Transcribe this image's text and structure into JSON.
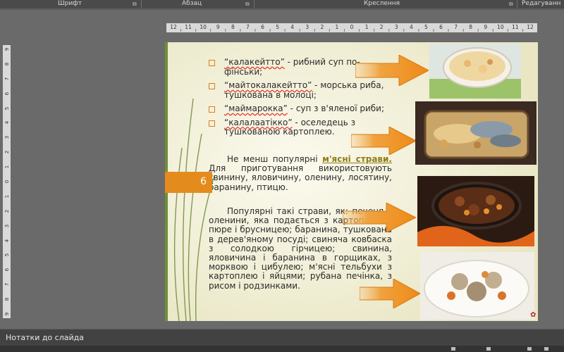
{
  "ribbon": {
    "groups": [
      "Шрифт",
      "Абзац",
      "Креслення",
      "Редагуванн"
    ]
  },
  "ruler": {
    "h_labels": [
      "12",
      "11",
      "10",
      "9",
      "8",
      "7",
      "6",
      "5",
      "4",
      "3",
      "2",
      "1",
      "0",
      "1",
      "2",
      "3",
      "4",
      "5",
      "6",
      "7",
      "8",
      "9",
      "10",
      "11",
      "12"
    ],
    "v_labels": [
      "9",
      "8",
      "7",
      "6",
      "5",
      "4",
      "3",
      "2",
      "1",
      "0",
      "1",
      "2",
      "3",
      "4",
      "5",
      "6",
      "7",
      "8",
      "9"
    ]
  },
  "slide": {
    "number": "6",
    "bullets": [
      {
        "term": "“калакейтто”",
        "rest": " - рибний суп по-фінськи;"
      },
      {
        "term": "“майтокалакейтто”",
        "rest": " - морська риба, тушкована в молоці;"
      },
      {
        "term": "“маймарокка”",
        "rest": " - суп з в'яленої риби;"
      },
      {
        "term": "“калалаатікко”",
        "rest": " - оселедець з тушкованою картоплею."
      }
    ],
    "para1": {
      "before": "Не менш популярні ",
      "highlight": "м'ясні страви.",
      "after": " Для приготування використовують свинину, яловичину, оленину, лосятину, баранину, птицю."
    },
    "para2": "Популярні такі страви, як: печеня з оленини, яка подається з картопляним пюре і брусницею; баранина, тушкована в дерев'яному посуді; свиняча ковбаска з солодкою гірчицею; свинина, яловичина і баранина в горщиках, з морквою і цибулею; м'ясні тельбухи з картоплею і яйцями; рубана печінка, з рисом і родзинками."
  },
  "notes": {
    "label": "Нотатки до слайда"
  },
  "colors": {
    "accent_orange": "#e48b1d",
    "bullet_orange": "#e07b1e",
    "highlight_olive": "#8f7c15",
    "slide_bg": "#f4f2dd"
  }
}
